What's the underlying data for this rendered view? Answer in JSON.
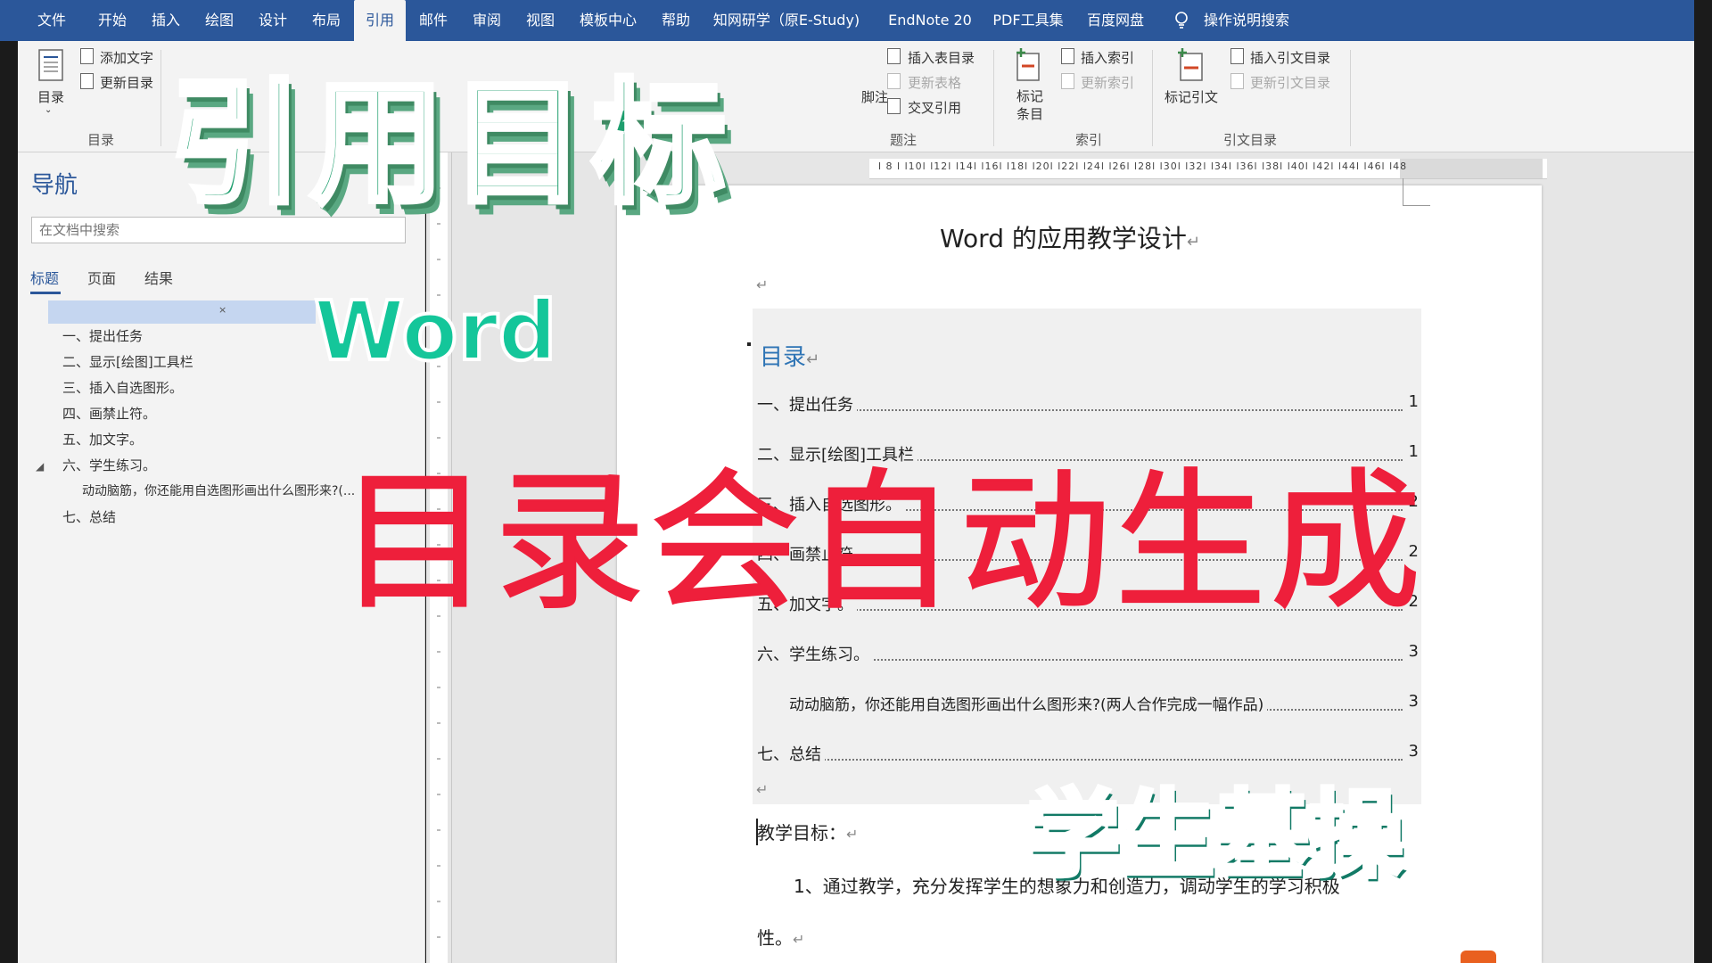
{
  "colors": {
    "ribbon_blue": "#2b579a",
    "caption_green": "#1e9e6e",
    "caption_red": "#ee1f3b",
    "toc_heading_blue": "#2e74b5"
  },
  "tabs": [
    "文件",
    "开始",
    "插入",
    "绘图",
    "设计",
    "布局",
    "引用",
    "邮件",
    "审阅",
    "视图",
    "模板中心",
    "帮助",
    "知网研学（原E-Study)",
    "EndNote 20",
    "PDF工具集",
    "百度网盘"
  ],
  "active_tab": "引用",
  "tell_me": "操作说明搜索",
  "ribbon": {
    "toc_button": "目录",
    "add_text": "添加文字",
    "update_toc": "更新目录",
    "group_toc": "目录",
    "insert_table_of_figures": "插入表目录",
    "update_table": "更新表格",
    "cross_reference": "交叉引用",
    "footnote_fragment": "脚注",
    "group_captions": "题注",
    "mark_entry": "标记条目",
    "insert_index": "插入索引",
    "update_index": "更新索引",
    "group_index": "索引",
    "mark_citation": "标记引文",
    "insert_toa": "插入引文目录",
    "update_toa": "更新引文目录",
    "group_toa": "引文目录"
  },
  "nav": {
    "title": "导航",
    "search_placeholder": "在文档中搜索",
    "tabs": [
      "标题",
      "页面",
      "结果"
    ],
    "items": [
      "一、提出任务",
      "二、显示[绘图]工具栏",
      "三、插入自选图形。",
      "四、画禁止符。",
      "五、加文字。",
      "六、学生练习。",
      "动动脑筋，你还能用自选图形画出什么图形来?(...",
      "七、总结"
    ]
  },
  "ruler_text": "l 8 l   l10l   l12l   l14l   l16l   l18l   l20l   l22l   l24l   l26l   l28l   l30l   l32l   l34l   l36l   l38l   l40l   l42l   l44l   l46l   l48",
  "document": {
    "title": "Word 的应用教学设计",
    "toc_heading": "目录",
    "toc": [
      {
        "label": "一、提出任务",
        "page": "1"
      },
      {
        "label": "二、显示[绘图]工具栏",
        "page": "1"
      },
      {
        "label": "三、插入自选图形。",
        "page": "2"
      },
      {
        "label": "四、画禁止符。",
        "page": "2"
      },
      {
        "label": "五、加文字。",
        "page": "2"
      },
      {
        "label": "六、学生练习。",
        "page": "3"
      },
      {
        "label": "动动脑筋，你还能用自选图形画出什么图形来?(两人合作完成一幅作品)",
        "page": "3"
      },
      {
        "label": "七、总结",
        "page": "3"
      }
    ],
    "objectives_heading": "教学目标：",
    "body_line1": "1、通过教学，充分发挥学生的想象力和创造力，调动学生的学习积极",
    "body_line2": "性。",
    "para_mark": "↵"
  },
  "captions": {
    "main": "引用目标",
    "word": "Word",
    "auto": "目录会自动生成",
    "student": "学生基操"
  }
}
